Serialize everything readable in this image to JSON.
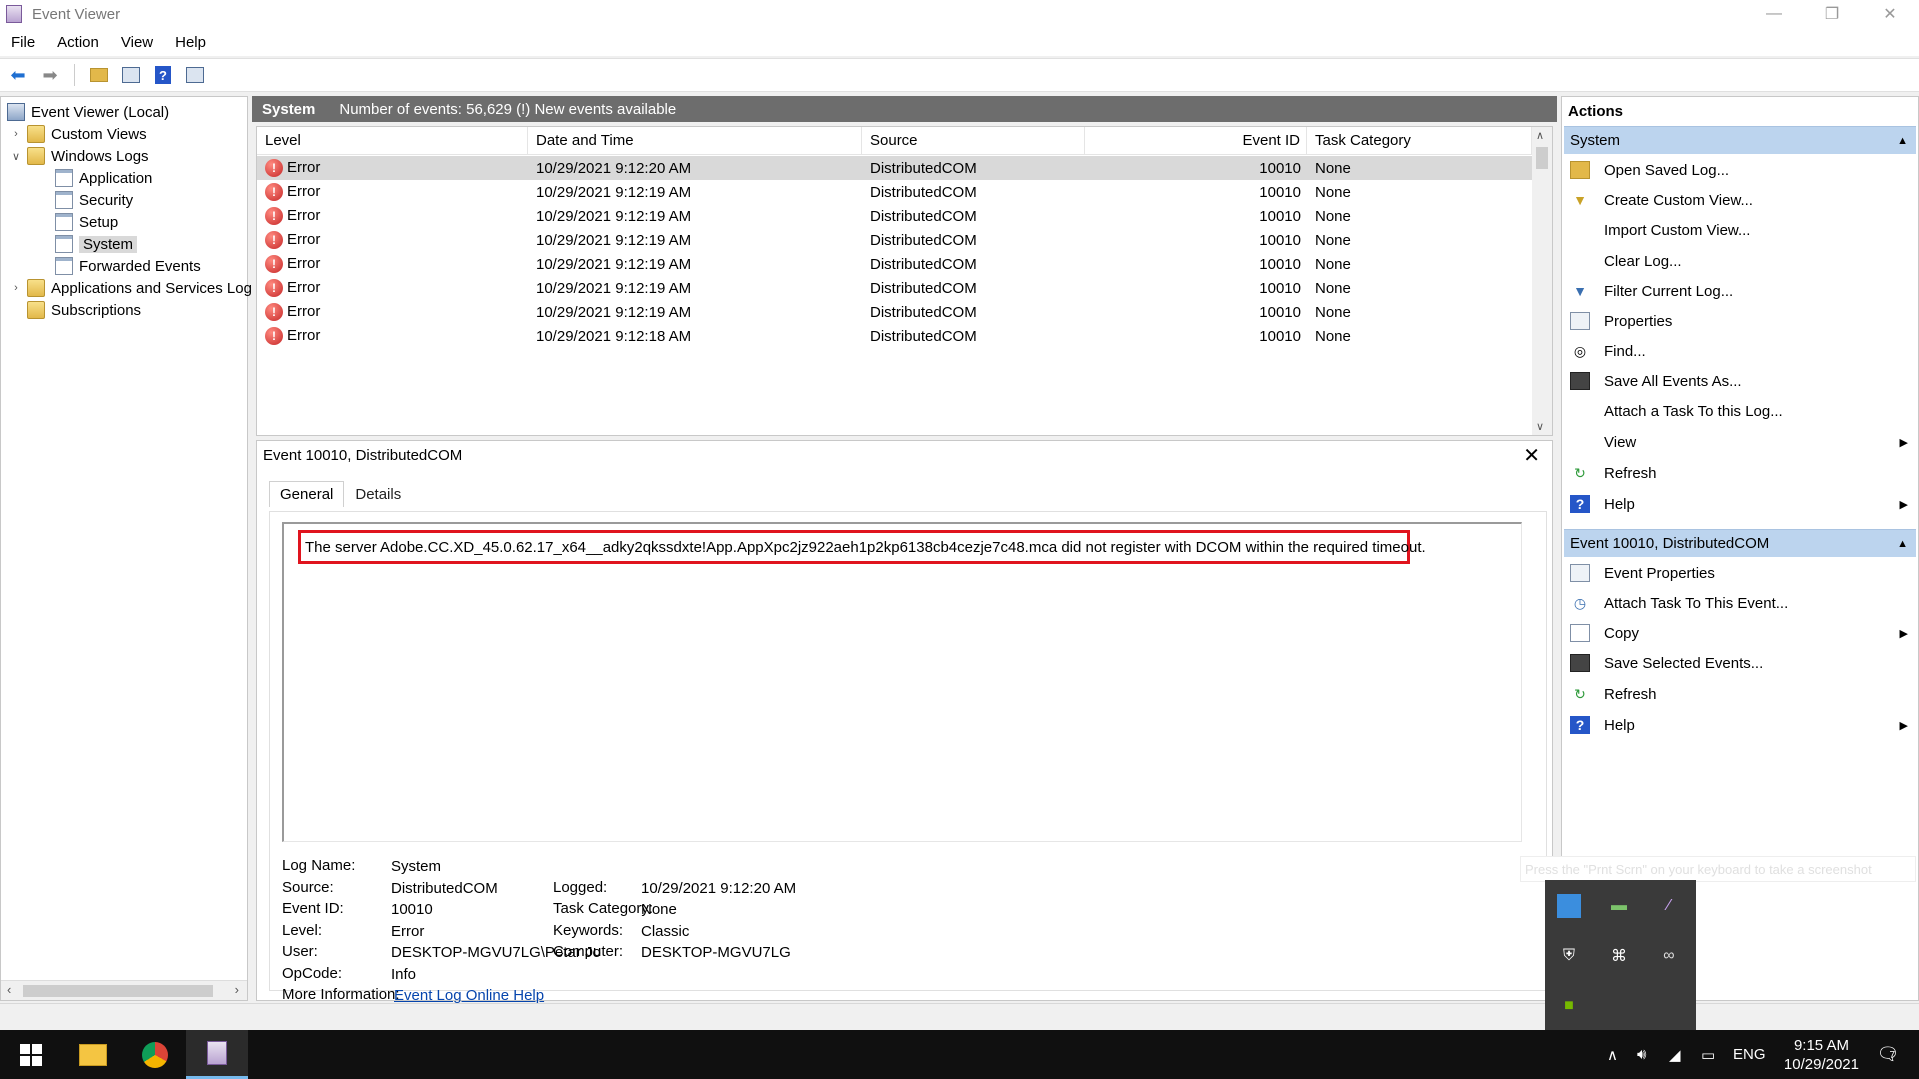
{
  "window": {
    "title": "Event Viewer",
    "minimize": "—",
    "restore": "❐",
    "close": "✕"
  },
  "menu": [
    "File",
    "Action",
    "View",
    "Help"
  ],
  "tree": {
    "root": "Event Viewer (Local)",
    "custom_views": "Custom Views",
    "windows_logs": "Windows Logs",
    "application": "Application",
    "security": "Security",
    "setup": "Setup",
    "system": "System",
    "forwarded": "Forwarded Events",
    "apps_services": "Applications and Services Log",
    "subscriptions": "Subscriptions"
  },
  "center": {
    "log_name": "System",
    "summary": "Number of events: 56,629 (!) New events available",
    "columns": [
      "Level",
      "Date and Time",
      "Source",
      "Event ID",
      "Task Category"
    ],
    "rows": [
      {
        "level": "Error",
        "date": "10/29/2021 9:12:20 AM",
        "source": "DistributedCOM",
        "id": "10010",
        "cat": "None"
      },
      {
        "level": "Error",
        "date": "10/29/2021 9:12:19 AM",
        "source": "DistributedCOM",
        "id": "10010",
        "cat": "None"
      },
      {
        "level": "Error",
        "date": "10/29/2021 9:12:19 AM",
        "source": "DistributedCOM",
        "id": "10010",
        "cat": "None"
      },
      {
        "level": "Error",
        "date": "10/29/2021 9:12:19 AM",
        "source": "DistributedCOM",
        "id": "10010",
        "cat": "None"
      },
      {
        "level": "Error",
        "date": "10/29/2021 9:12:19 AM",
        "source": "DistributedCOM",
        "id": "10010",
        "cat": "None"
      },
      {
        "level": "Error",
        "date": "10/29/2021 9:12:19 AM",
        "source": "DistributedCOM",
        "id": "10010",
        "cat": "None"
      },
      {
        "level": "Error",
        "date": "10/29/2021 9:12:19 AM",
        "source": "DistributedCOM",
        "id": "10010",
        "cat": "None"
      },
      {
        "level": "Error",
        "date": "10/29/2021 9:12:18 AM",
        "source": "DistributedCOM",
        "id": "10010",
        "cat": "None"
      }
    ]
  },
  "detail": {
    "title": "Event 10010, DistributedCOM",
    "tab_general": "General",
    "tab_details": "Details",
    "message": "The server Adobe.CC.XD_45.0.62.17_x64__adky2qkssdxte!App.AppXpc2jz922aeh1p2kp6138cb4cezje7c48.mca did not register with DCOM within the required timeout.",
    "labels": {
      "log_name": "Log Name:",
      "source": "Source:",
      "event_id": "Event ID:",
      "level": "Level:",
      "user": "User:",
      "opcode": "OpCode:",
      "more_info": "More Information:",
      "logged": "Logged:",
      "task_category": "Task Category:",
      "keywords": "Keywords:",
      "computer": "Computer:"
    },
    "values": {
      "log_name": "System",
      "source": "DistributedCOM",
      "event_id": "10010",
      "level": "Error",
      "user": "DESKTOP-MGVU7LG\\Petar Jo",
      "opcode": "Info",
      "more_info_link": "Event Log Online Help",
      "logged": "10/29/2021 9:12:20 AM",
      "task_category": "None",
      "keywords": "Classic",
      "computer": "DESKTOP-MGVU7LG"
    }
  },
  "actions": {
    "title": "Actions",
    "section1": "System",
    "items1": [
      "Open Saved Log...",
      "Create Custom View...",
      "Import Custom View...",
      "Clear Log...",
      "Filter Current Log...",
      "Properties",
      "Find...",
      "Save All Events As...",
      "Attach a Task To this Log...",
      "View",
      "Refresh",
      "Help"
    ],
    "section2": "Event 10010, DistributedCOM",
    "items2": [
      "Event Properties",
      "Attach Task To This Event...",
      "Copy",
      "Save Selected Events...",
      "Refresh",
      "Help"
    ]
  },
  "tray_hint": "Press the \"Prnt Scrn\" on your keyboard to take a screenshot",
  "taskbar": {
    "lang": "ENG",
    "time": "9:15 AM",
    "date": "10/29/2021",
    "notif_count": "7"
  },
  "colors": {
    "highlight": "#e0141e",
    "section_bg": "#bcd4ee",
    "header_bg": "#6d6d6d",
    "link": "#0645ad"
  }
}
